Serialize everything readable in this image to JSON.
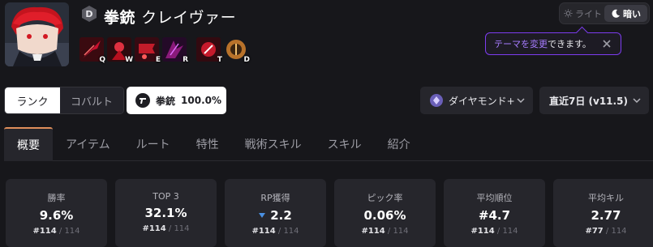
{
  "character": {
    "grade": "D",
    "weapon": "拳銃",
    "name": "クレイヴァー"
  },
  "skills": [
    {
      "key": "Q",
      "color": "#c8102e"
    },
    {
      "key": "W",
      "color": "#b5101f"
    },
    {
      "key": "E",
      "color": "#c21c2a"
    },
    {
      "key": "R",
      "color": "#8a1a7a"
    },
    {
      "key": "T",
      "color": "#c51a2c"
    },
    {
      "key": "D",
      "color": "#b8722a"
    }
  ],
  "theme": {
    "light_label": "ライト",
    "dark_label": "暗い",
    "tooltip_prefix": "",
    "tooltip_highlight": "テーマを変更",
    "tooltip_suffix": "できます。"
  },
  "filters": {
    "mode_options": [
      "ランク",
      "コバルト"
    ],
    "weapon_label": "拳銃",
    "weapon_pct": "100.0%",
    "tier_label": "ダイヤモンド+",
    "period_label": "直近7日 (v11.5)"
  },
  "tabs": [
    "概要",
    "アイテム",
    "ルート",
    "特性",
    "戦術スキル",
    "スキル",
    "紹介"
  ],
  "stats": [
    {
      "label": "勝率",
      "value": "9.6%",
      "rank": "#114",
      "total": " / 114",
      "trend": ""
    },
    {
      "label": "TOP 3",
      "value": "32.1%",
      "rank": "#114",
      "total": " / 114",
      "trend": ""
    },
    {
      "label": "RP獲得",
      "value": "2.2",
      "rank": "#114",
      "total": " / 114",
      "trend": "down"
    },
    {
      "label": "ピック率",
      "value": "0.06%",
      "rank": "#114",
      "total": " / 114",
      "trend": ""
    },
    {
      "label": "平均順位",
      "value": "#4.7",
      "rank": "#114",
      "total": " / 114",
      "trend": ""
    },
    {
      "label": "平均キル",
      "value": "2.77",
      "rank": "#77",
      "total": " / 114",
      "trend": ""
    }
  ],
  "colors": {
    "accent_tab": "#e08f5b",
    "tooltip_border": "#7d3cf0",
    "trend_down": "#4a90e2"
  }
}
